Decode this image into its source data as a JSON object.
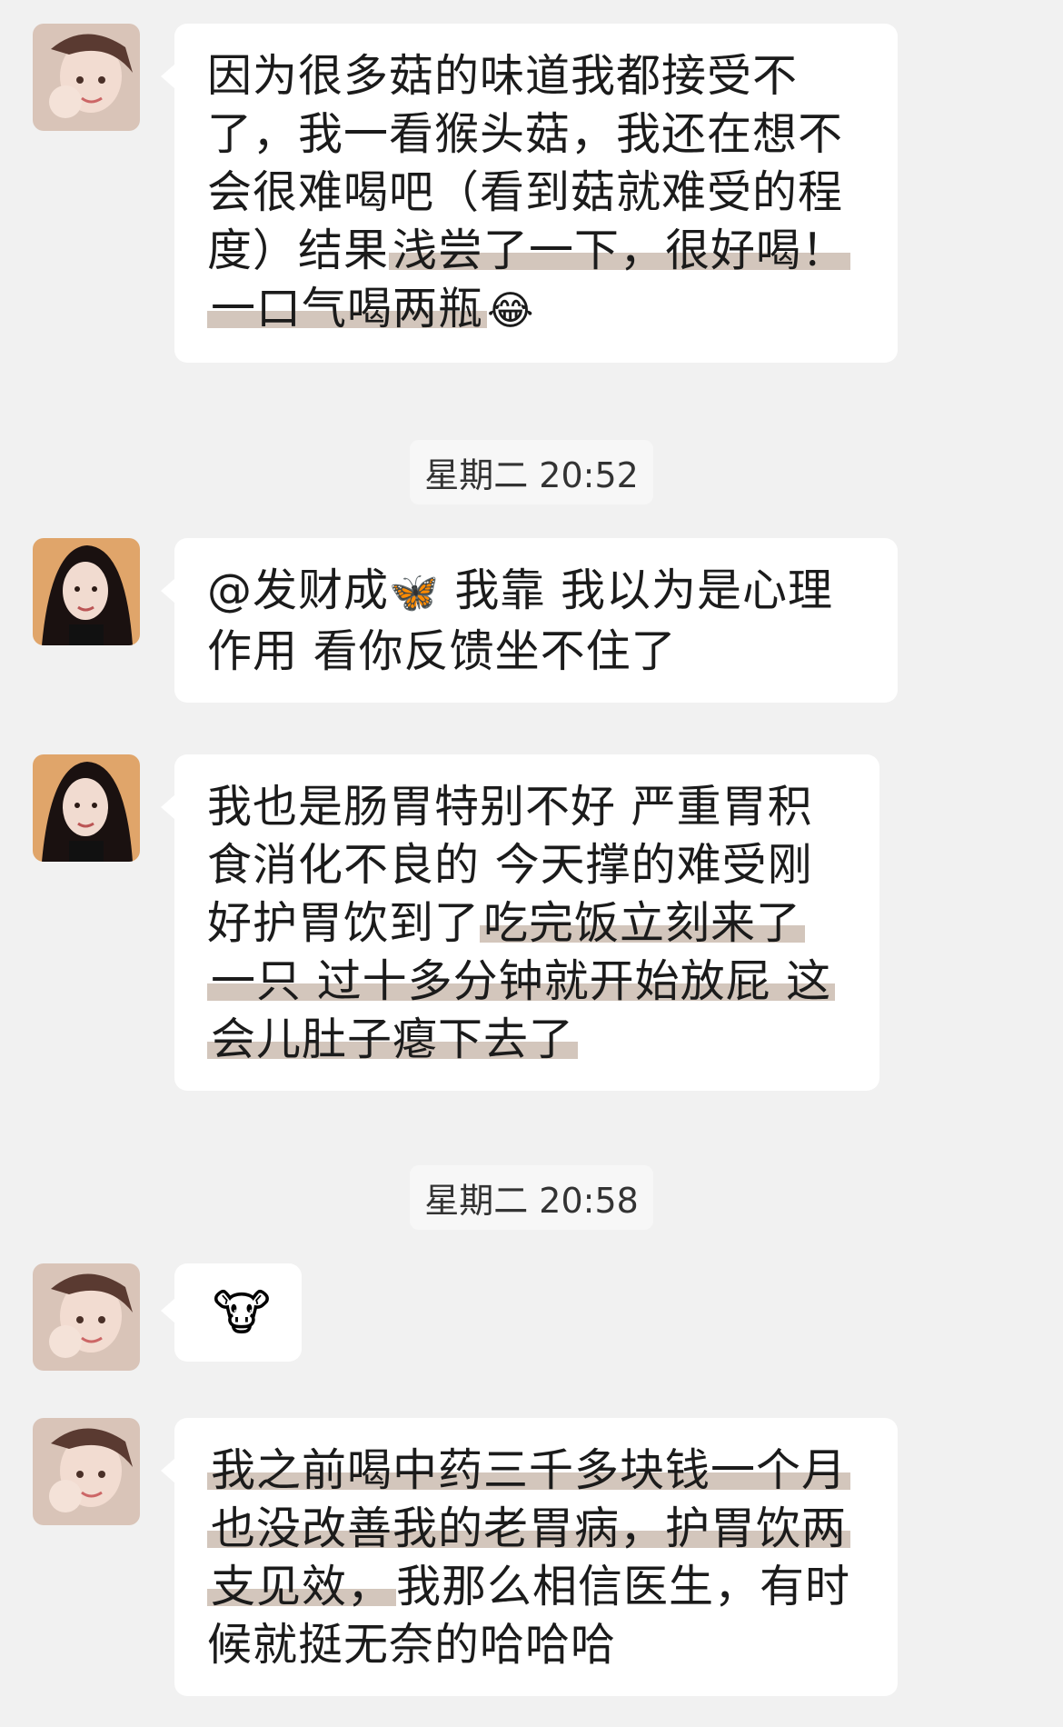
{
  "messages": [
    {
      "sender": "user-a",
      "parts": [
        "因为很多菇的味道我都接受不了，我一看猴头菇，我还在想不会很难喝吧（看到菇就难受的程度）结果",
        "浅尝了一下，很好喝！一口气喝两瓶",
        "😂"
      ]
    },
    {
      "timestamp": "星期二 20:52"
    },
    {
      "sender": "user-b",
      "parts": [
        "@发财成",
        "🦋",
        " 我靠 我以为是心理作用 看你反馈坐不住了"
      ]
    },
    {
      "sender": "user-b",
      "parts": [
        "我也是肠胃特别不好 严重胃积食消化不良的 今天撑的难受刚好护胃饮到了",
        "吃完饭立刻来了一只 过十多分钟就开始放屁 这会儿肚子瘪下去了"
      ]
    },
    {
      "timestamp": "星期二 20:58"
    },
    {
      "sender": "user-a",
      "emoji": "🐮"
    },
    {
      "sender": "user-a",
      "parts": [
        "我之前喝中药三千多块钱一个月也没改善我的老胃病，护胃饮两支见效，",
        "我那么相信医生，有时候就挺无奈的哈哈哈"
      ]
    }
  ]
}
